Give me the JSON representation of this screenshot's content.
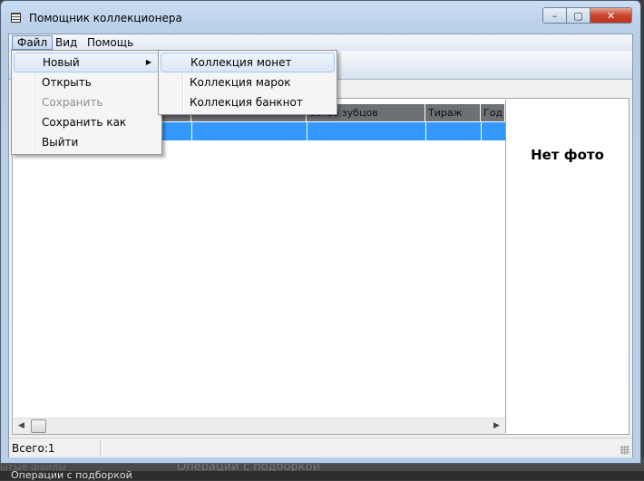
{
  "window": {
    "title": "Помощник коллекционера",
    "buttons": {
      "minimize": "–",
      "maximize": "▢",
      "close": "✕"
    }
  },
  "menubar": {
    "items": [
      {
        "label": "Файл"
      },
      {
        "label": "Вид"
      },
      {
        "label": "Помощь"
      }
    ]
  },
  "file_menu": {
    "items": [
      {
        "label": "Новый",
        "enabled": true,
        "has_submenu": true
      },
      {
        "label": "Открыть",
        "enabled": true
      },
      {
        "label": "Сохранить",
        "enabled": false
      },
      {
        "label": "Сохранить как",
        "enabled": true
      },
      {
        "label": "Выйти",
        "enabled": true
      }
    ]
  },
  "new_submenu": {
    "items": [
      {
        "label": "Коллекция монет"
      },
      {
        "label": "Коллекция марок"
      },
      {
        "label": "Коллекция банкнот"
      }
    ]
  },
  "grid": {
    "columns": [
      "ество зубцов",
      "Тираж",
      "Год"
    ],
    "selected_row_color": "#3399ff"
  },
  "photo": {
    "label": "Нет фото"
  },
  "status": {
    "text": "Всего:1"
  },
  "background_window": {
    "left_text": "ытые файлы",
    "center_text": "Операции с подборкой",
    "bottom_text": "Операции с подборкой"
  },
  "colors": {
    "accent": "#3399ff",
    "close_button": "#c9452f"
  }
}
